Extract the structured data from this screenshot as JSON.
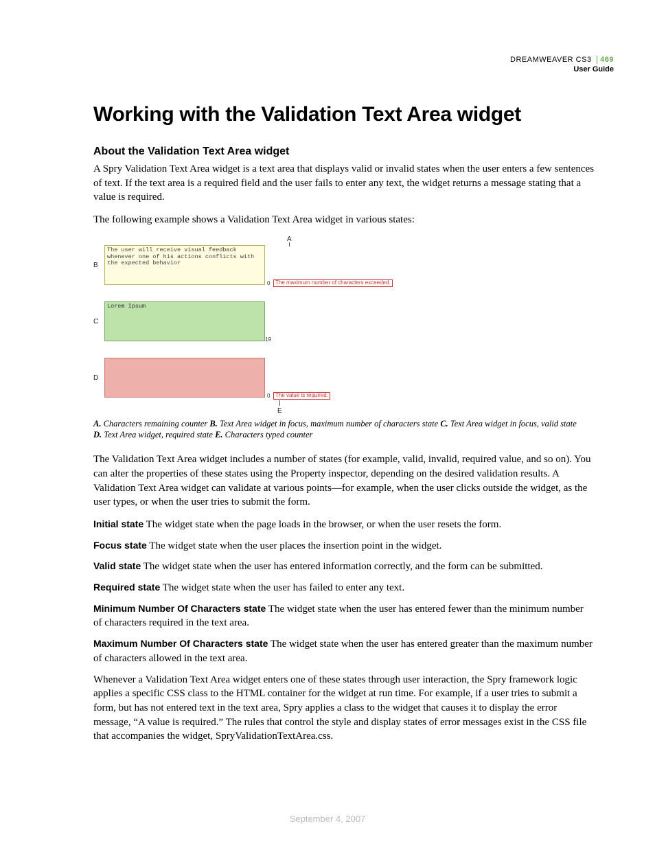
{
  "header": {
    "product": "DREAMWEAVER CS3",
    "page_number": "469",
    "subtitle": "User Guide"
  },
  "title": "Working with the Validation Text Area widget",
  "section_heading": "About the Validation Text Area widget",
  "intro_para": "A Spry Validation Text Area widget is a text area that displays valid or invalid states when the user enters a few sentences of text. If the text area is a required field and the user fails to enter any text, the widget returns a message stating that a value is required.",
  "example_intro": "The following example shows a Validation Text Area widget in various states:",
  "figure": {
    "letters": {
      "A": "A",
      "B": "B",
      "C": "C",
      "D": "D",
      "E": "E"
    },
    "textarea_b_text": "The user will receive visual feedback whenever one of his actions conflicts with the expected behavior",
    "textarea_c_text": "Lorem Ipsum",
    "counter_a": "0",
    "counter_c": "19",
    "counter_d": "0",
    "error_b": "The maximum number of characters exceeded.",
    "error_d": "The value is required."
  },
  "caption": {
    "A": {
      "key": "A.",
      "text": " Characters remaining counter  "
    },
    "B": {
      "key": "B.",
      "text": " Text Area widget in focus, maximum number of characters state  "
    },
    "C": {
      "key": "C.",
      "text": " Text Area widget in focus, valid state "
    },
    "D": {
      "key": "D.",
      "text": " Text Area widget, required state  "
    },
    "E": {
      "key": "E.",
      "text": " Characters typed counter"
    }
  },
  "para_after_figure": "The Validation Text Area widget includes a number of states (for example, valid, invalid, required value, and so on). You can alter the properties of these states using the Property inspector, depending on the desired validation results. A Validation Text Area widget can validate at various points—for example, when the user clicks outside the widget, as the user types, or when the user tries to submit the form.",
  "states": {
    "initial": {
      "term": "Initial state",
      "desc": "  The widget state when the page loads in the browser, or when the user resets the form."
    },
    "focus": {
      "term": "Focus state",
      "desc": "  The widget state when the user places the insertion point in the widget."
    },
    "valid": {
      "term": "Valid state",
      "desc": "  The widget state when the user has entered information correctly, and the form can be submitted."
    },
    "required": {
      "term": "Required state",
      "desc": "  The widget state when the user has failed to enter any text."
    },
    "min": {
      "term": "Minimum Number Of Characters state",
      "desc": "  The widget state when the user has entered fewer than the minimum number of characters required in the text area."
    },
    "max": {
      "term": "Maximum Number Of Characters state",
      "desc": "  The widget state when the user has entered greater than the maximum number of characters allowed in the text area."
    }
  },
  "closing_para": "Whenever a Validation Text Area widget enters one of these states through user interaction, the Spry framework logic applies a specific CSS class to the HTML container for the widget at run time. For example, if a user tries to submit a form, but has not entered text in the text area, Spry applies a class to the widget that causes it to display the error message, “A value is required.” The rules that control the style and display states of error messages exist in the CSS file that accompanies the widget, SpryValidationTextArea.css.",
  "footer_date": "September 4, 2007"
}
